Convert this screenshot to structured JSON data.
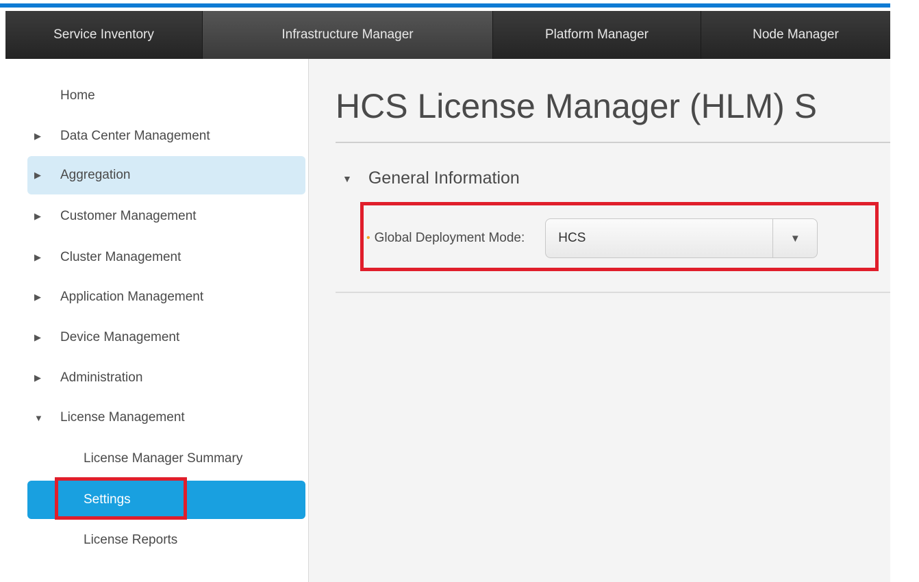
{
  "topnav": {
    "tabs": [
      {
        "label": "Service Inventory"
      },
      {
        "label": "Infrastructure Manager"
      },
      {
        "label": "Platform Manager"
      },
      {
        "label": "Node Manager"
      }
    ],
    "active_tab": "Infrastructure Manager"
  },
  "sidebar": {
    "items": [
      {
        "label": "Home"
      },
      {
        "label": "Data Center Management"
      },
      {
        "label": "Aggregation"
      },
      {
        "label": "Customer Management"
      },
      {
        "label": "Cluster Management"
      },
      {
        "label": "Application Management"
      },
      {
        "label": "Device Management"
      },
      {
        "label": "Administration"
      },
      {
        "label": "License Management"
      },
      {
        "label": "License Manager Summary"
      },
      {
        "label": "Settings"
      },
      {
        "label": "License Reports"
      }
    ],
    "selected": "Settings",
    "hovered": "Aggregation",
    "expanded": "License Management"
  },
  "main": {
    "title": "HCS License Manager (HLM) S",
    "section": {
      "title": "General Information",
      "field": {
        "label": "Global Deployment Mode:",
        "value": "HCS"
      }
    }
  },
  "colors": {
    "accent_blue": "#0f7bd4",
    "selected_item": "#19a0e0",
    "hover_item": "#d6ebf7",
    "highlight_red": "#e01e2b",
    "required_marker": "#f5a623"
  }
}
